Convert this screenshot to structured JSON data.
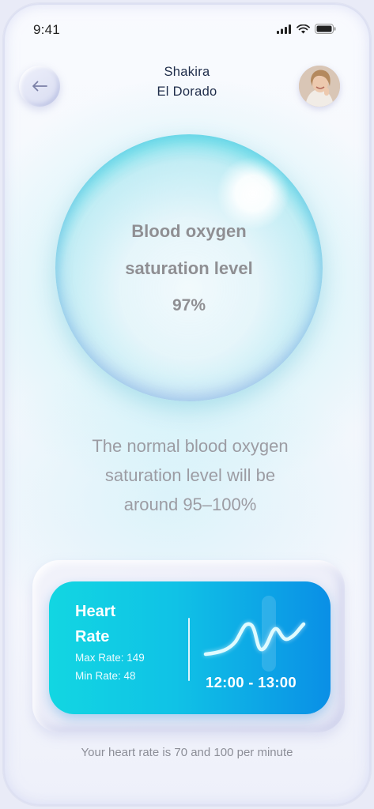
{
  "status_bar": {
    "time": "9:41",
    "icons": [
      "signal-icon",
      "wifi-icon",
      "battery-icon"
    ]
  },
  "header": {
    "title_line1": "Shakira",
    "title_line2": "El Dorado",
    "back_icon": "arrow-left-icon",
    "avatar": "user-avatar"
  },
  "oxygen": {
    "label_line1": "Blood oxygen",
    "label_line2": "saturation level",
    "value": "97%"
  },
  "info": {
    "line1": "The normal blood oxygen",
    "line2": "saturation level will be",
    "line3": "around 95–100%"
  },
  "heart_card": {
    "title_line1": "Heart",
    "title_line2": "Rate",
    "max_rate": "Max Rate: 149",
    "min_rate": "Min Rate: 48",
    "time_range": "12:00 - 13:00"
  },
  "footer": {
    "text": "Your heart rate is 70 and 100 per minute"
  },
  "colors": {
    "card_start": "#12d6e2",
    "card_end": "#0a8fe6",
    "bubble_edge": "#42d4e2"
  }
}
